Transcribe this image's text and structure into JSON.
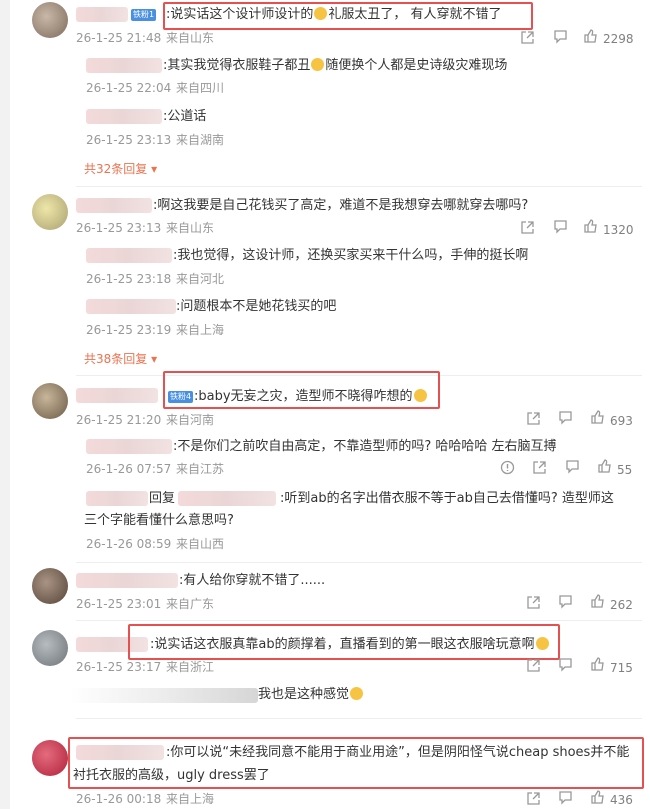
{
  "colors": {
    "accent": "#eb7350",
    "highlight": "#e55050",
    "meta": "#999999",
    "badge": "#4a90e2"
  },
  "c1": {
    "badge": "铁粉1",
    "text": ":说实话这个设计师设计的",
    "text2": "礼服太丑了，  有人穿就不错了",
    "time": "26-1-25 21:48",
    "loc": "来自山东",
    "likes": "2298",
    "r1": {
      "text": ":其实我觉得衣服鞋子都丑",
      "text2": "随便换个人都是史诗级灾难现场",
      "time": "26-1-25 22:04",
      "loc": "来自四川"
    },
    "r2": {
      "text": ":公道话",
      "time": "26-1-25 23:13",
      "loc": "来自湖南"
    },
    "more": "共32条回复"
  },
  "c2": {
    "text": ":啊这我要是自己花钱买了高定，难道不是我想穿去哪就穿去哪吗?",
    "time": "26-1-25 23:13",
    "loc": "来自山东",
    "likes": "1320",
    "r1": {
      "text": ":我也觉得，这设计师，还换买家买来干什么吗，手伸的挺长啊",
      "time": "26-1-25 23:18",
      "loc": "来自河北"
    },
    "r2": {
      "text": ":问题根本不是她花钱买的吧",
      "time": "26-1-25 23:19",
      "loc": "来自上海"
    },
    "more": "共38条回复"
  },
  "c3": {
    "badge": "铁粉4",
    "text": ":baby无妄之灾，造型师不晓得咋想的",
    "time": "26-1-25 21:20",
    "loc": "来自河南",
    "likes": "693",
    "r1": {
      "text": ":不是你们之前吹自由高定，不靠造型师的吗? 哈哈哈哈 左右脑互搏",
      "time": "26-1-26 07:57",
      "loc": "来自江苏",
      "likes": "55"
    },
    "r2": {
      "reply_word": "回复",
      "text": ":听到ab的名字出借衣服不等于ab自己去借懂吗? 造型师这",
      "text2": "三个字能看懂什么意思吗?",
      "time": "26-1-26 08:59",
      "loc": "来自山西"
    }
  },
  "c4": {
    "text": ":有人给你穿就不错了......",
    "time": "26-1-25 23:01",
    "loc": "来自广东",
    "likes": "262"
  },
  "c5": {
    "text": ":说实话这衣服真靠ab的颜撑着，直播看到的第一眼这衣服啥玩意啊",
    "time": "26-1-25 23:17",
    "loc": "来自浙江",
    "likes": "715"
  },
  "c6": {
    "text": "我也是这种感觉"
  },
  "c7": {
    "text": ":你可以说“未经我同意不能用于商业用途”，但是阴阳怪气说cheap shoes并不能",
    "text2": "衬托衣服的高级，ugly dress罢了",
    "time": "26-1-26 00:18",
    "loc": "来自上海",
    "likes": "436"
  }
}
